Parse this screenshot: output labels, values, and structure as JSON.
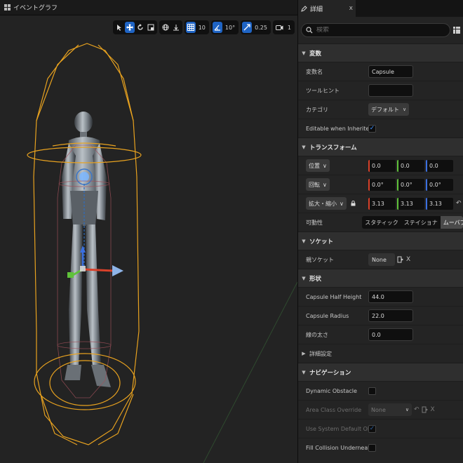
{
  "left_panel": {
    "tab_title": "イベントグラフ"
  },
  "toolbar": {
    "grid_snap": "10",
    "rotation_snap": "10°",
    "scale_snap": "0.25",
    "camera_speed": "1"
  },
  "details": {
    "tab_title": "詳細",
    "close_label": "x",
    "search_placeholder": "検索",
    "sections": {
      "variables": "変数",
      "transform": "トランスフォーム",
      "socket": "ソケット",
      "shape": "形状",
      "advanced": "詳細設定",
      "navigation": "ナビゲーション"
    },
    "variables": {
      "name_label": "変数名",
      "name_value": "Capsule",
      "tooltip_label": "ツールヒント",
      "tooltip_value": "",
      "category_label": "カテゴリ",
      "category_value": "デフォルト",
      "editable_label": "Editable when Inherited",
      "editable_checked": true
    },
    "transform": {
      "location_label": "位置",
      "location": [
        "0.0",
        "0.0",
        "0.0"
      ],
      "rotation_label": "回転",
      "rotation": [
        "0.0°",
        "0.0°",
        "0.0°"
      ],
      "scale_label": "拡大・縮小",
      "scale": [
        "3.13",
        "3.13",
        "3.13"
      ],
      "mobility_label": "可動性",
      "mobility_options": [
        "スタティック",
        "ステイショナ",
        "ムーバブル"
      ],
      "mobility_selected": "ムーバブル"
    },
    "socket": {
      "parent_label": "親ソケット",
      "parent_value": "None"
    },
    "shape": {
      "half_height_label": "Capsule Half Height",
      "half_height_value": "44.0",
      "radius_label": "Capsule Radius",
      "radius_value": "22.0",
      "line_thickness_label": "線の太さ",
      "line_thickness_value": "0.0"
    },
    "navigation": {
      "dynamic_obstacle_label": "Dynamic Obstacle",
      "area_class_label": "Area Class Override",
      "area_class_value": "None",
      "use_system_default_label": "Use System Default Obstacle...",
      "fill_collision_label": "Fill Collision Underneath for N..."
    }
  },
  "colors": {
    "accent": "#1f64c4",
    "capsule": "#e8a21f",
    "axis_x": "#d9412a",
    "axis_y": "#5fc23a",
    "axis_z": "#3b6fe0"
  }
}
